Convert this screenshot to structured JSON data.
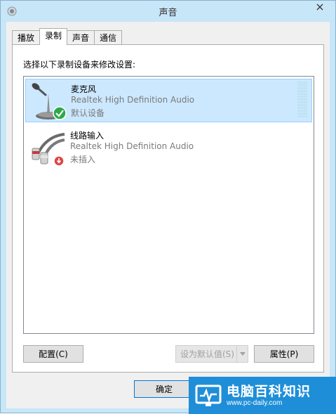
{
  "window": {
    "title": "声音",
    "close_icon": "close-icon",
    "app_icon": "speaker-icon"
  },
  "tabs": [
    {
      "label": "播放"
    },
    {
      "label": "录制",
      "active": true
    },
    {
      "label": "声音"
    },
    {
      "label": "通信"
    }
  ],
  "panel": {
    "instruction": "选择以下录制设备来修改设置:"
  },
  "devices": [
    {
      "name": "麦克风",
      "driver": "Realtek High Definition Audio",
      "status": "默认设备",
      "icon": "microphone-icon",
      "badge": "default-check-icon",
      "selected": true
    },
    {
      "name": "线路输入",
      "driver": "Realtek High Definition Audio",
      "status": "未插入",
      "icon": "line-in-cable-icon",
      "badge": "unplugged-icon",
      "selected": false
    }
  ],
  "buttons": {
    "configure": "配置(C)",
    "set_default": "设为默认值(S)",
    "properties": "属性(P)",
    "ok": "确定"
  },
  "watermark": {
    "title": "电脑百科知识",
    "url": "www.pc-daily.com"
  },
  "colors": {
    "selection": "#cce8ff",
    "accent": "#1f8ed8"
  }
}
